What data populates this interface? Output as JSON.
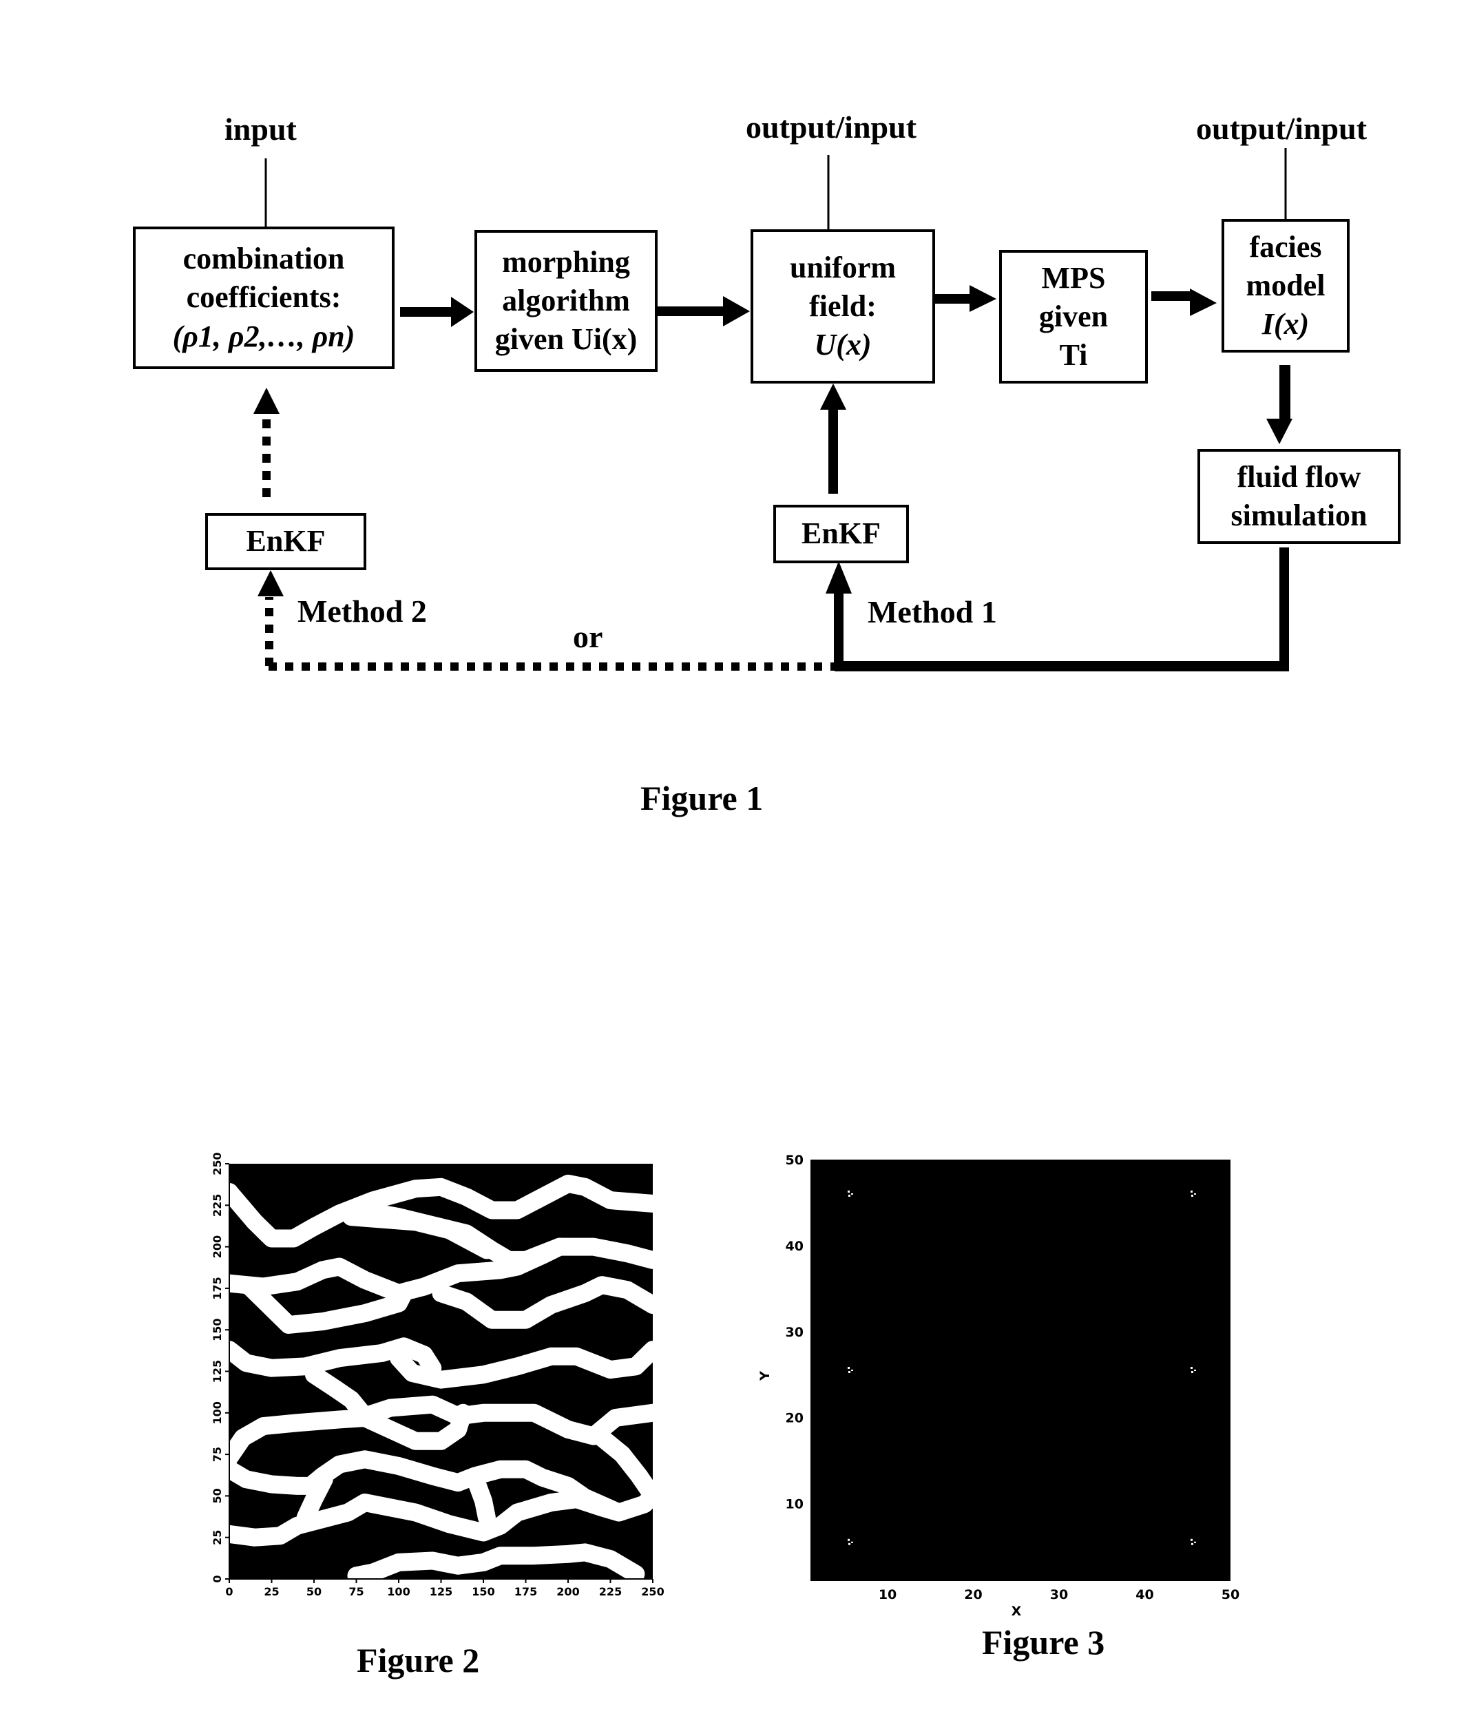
{
  "figure1": {
    "caption": "Figure 1",
    "top_labels": {
      "combination": "input",
      "uniform": "output/input",
      "facies": "output/input"
    },
    "boxes": {
      "combination": {
        "lines": [
          "combination",
          "coefficients:",
          "(ρ1, ρ2,…, ρn)"
        ]
      },
      "morphing": {
        "lines": [
          "morphing",
          "algorithm",
          "given Ui(x)"
        ]
      },
      "uniform": {
        "lines": [
          "uniform",
          "field:",
          "U(x)"
        ]
      },
      "mps": {
        "lines": [
          "MPS",
          "given",
          "Ti"
        ]
      },
      "facies": {
        "lines": [
          "facies",
          "model",
          "I(x)"
        ]
      },
      "fluid": {
        "lines": [
          "fluid flow",
          "simulation"
        ]
      },
      "enkf_method2": {
        "lines": [
          "EnKF"
        ]
      },
      "enkf_method1": {
        "lines": [
          "EnKF"
        ]
      }
    },
    "method_labels": {
      "method2": "Method 2",
      "method1": "Method 1",
      "or": "or"
    }
  },
  "figure2": {
    "caption": "Figure 2"
  },
  "figure3": {
    "caption": "Figure 3"
  },
  "chart_data": [
    {
      "type": "heatmap",
      "title": "Figure 2",
      "description": "Binary facies training image: white sinuous channels on black background",
      "xlabel": "",
      "ylabel": "",
      "xlim": [
        0,
        250
      ],
      "ylim": [
        0,
        250
      ],
      "x_ticks": [
        0,
        25,
        50,
        75,
        100,
        125,
        150,
        175,
        200,
        225,
        250
      ],
      "y_ticks": [
        0,
        25,
        50,
        75,
        100,
        125,
        150,
        175,
        200,
        225,
        250
      ],
      "colors": {
        "background": "#000000",
        "channel": "#ffffff"
      },
      "channel_centerlines": [
        [
          [
            0,
            233
          ],
          [
            15,
            215
          ],
          [
            25,
            205
          ],
          [
            38,
            205
          ],
          [
            50,
            212
          ],
          [
            65,
            220
          ],
          [
            85,
            228
          ],
          [
            110,
            235
          ],
          [
            125,
            236
          ],
          [
            140,
            230
          ],
          [
            155,
            222
          ],
          [
            170,
            222
          ],
          [
            185,
            230
          ],
          [
            200,
            238
          ],
          [
            210,
            236
          ],
          [
            225,
            228
          ],
          [
            250,
            226
          ]
        ],
        [
          [
            78,
            222
          ],
          [
            100,
            218
          ],
          [
            120,
            213
          ],
          [
            140,
            208
          ],
          [
            155,
            198
          ],
          [
            165,
            192
          ],
          [
            175,
            192
          ],
          [
            195,
            200
          ],
          [
            215,
            200
          ],
          [
            235,
            196
          ],
          [
            250,
            192
          ]
        ],
        [
          [
            72,
            218
          ],
          [
            110,
            215
          ],
          [
            130,
            210
          ],
          [
            152,
            198
          ]
        ],
        [
          [
            0,
            178
          ],
          [
            20,
            176
          ],
          [
            40,
            179
          ],
          [
            55,
            186
          ],
          [
            65,
            188
          ],
          [
            80,
            180
          ],
          [
            100,
            172
          ],
          [
            115,
            176
          ],
          [
            135,
            184
          ],
          [
            160,
            186
          ],
          [
            170,
            188
          ],
          [
            185,
            195
          ],
          [
            195,
            200
          ]
        ],
        [
          [
            12,
            176
          ],
          [
            25,
            163
          ],
          [
            35,
            153
          ],
          [
            55,
            155
          ],
          [
            80,
            160
          ],
          [
            100,
            166
          ],
          [
            103,
            172
          ]
        ],
        [
          [
            125,
            172
          ],
          [
            140,
            167
          ],
          [
            155,
            156
          ],
          [
            175,
            156
          ],
          [
            190,
            165
          ],
          [
            210,
            172
          ],
          [
            220,
            177
          ],
          [
            235,
            174
          ],
          [
            250,
            165
          ]
        ],
        [
          [
            0,
            138
          ],
          [
            10,
            130
          ],
          [
            25,
            127
          ],
          [
            45,
            128
          ],
          [
            65,
            133
          ],
          [
            90,
            136
          ],
          [
            103,
            140
          ],
          [
            115,
            135
          ],
          [
            120,
            127
          ]
        ],
        [
          [
            100,
            133
          ],
          [
            108,
            124
          ],
          [
            125,
            120
          ],
          [
            150,
            123
          ],
          [
            170,
            128
          ],
          [
            190,
            134
          ],
          [
            205,
            134
          ],
          [
            225,
            126
          ],
          [
            240,
            128
          ],
          [
            250,
            138
          ]
        ],
        [
          [
            50,
            123
          ],
          [
            62,
            115
          ],
          [
            72,
            108
          ],
          [
            80,
            98
          ],
          [
            95,
            103
          ],
          [
            120,
            105
          ],
          [
            135,
            98
          ],
          [
            150,
            100
          ],
          [
            180,
            100
          ],
          [
            200,
            90
          ],
          [
            215,
            86
          ],
          [
            228,
            97
          ],
          [
            250,
            100
          ]
        ],
        [
          [
            0,
            73
          ],
          [
            8,
            85
          ],
          [
            20,
            92
          ],
          [
            40,
            94
          ],
          [
            65,
            96
          ],
          [
            80,
            97
          ],
          [
            95,
            90
          ],
          [
            110,
            83
          ],
          [
            125,
            83
          ],
          [
            135,
            90
          ],
          [
            138,
            100
          ]
        ],
        [
          [
            0,
            66
          ],
          [
            10,
            60
          ],
          [
            25,
            57
          ],
          [
            40,
            56
          ],
          [
            48,
            56
          ],
          [
            55,
            62
          ],
          [
            65,
            69
          ],
          [
            80,
            72
          ],
          [
            100,
            68
          ],
          [
            120,
            62
          ],
          [
            135,
            58
          ],
          [
            145,
            62
          ],
          [
            160,
            66
          ],
          [
            175,
            66
          ],
          [
            185,
            61
          ],
          [
            200,
            56
          ],
          [
            210,
            49
          ],
          [
            230,
            40
          ],
          [
            245,
            45
          ],
          [
            250,
            50
          ]
        ],
        [
          [
            220,
            85
          ],
          [
            232,
            75
          ],
          [
            242,
            62
          ],
          [
            250,
            50
          ]
        ],
        [
          [
            45,
            37
          ],
          [
            50,
            48
          ],
          [
            56,
            60
          ]
        ],
        [
          [
            0,
            27
          ],
          [
            15,
            25
          ],
          [
            30,
            26
          ],
          [
            40,
            32
          ],
          [
            55,
            36
          ],
          [
            70,
            40
          ],
          [
            80,
            46
          ],
          [
            95,
            43
          ],
          [
            110,
            40
          ],
          [
            130,
            33
          ],
          [
            150,
            28
          ],
          [
            160,
            32
          ],
          [
            170,
            40
          ],
          [
            190,
            46
          ],
          [
            205,
            48
          ],
          [
            220,
            43
          ],
          [
            230,
            40
          ]
        ],
        [
          [
            146,
            58
          ],
          [
            150,
            47
          ],
          [
            152,
            37
          ]
        ],
        [
          [
            75,
            2
          ],
          [
            85,
            4
          ],
          [
            100,
            10
          ],
          [
            120,
            11
          ],
          [
            135,
            8
          ],
          [
            150,
            10
          ],
          [
            160,
            14
          ],
          [
            180,
            14
          ],
          [
            200,
            15
          ],
          [
            210,
            16
          ],
          [
            225,
            12
          ],
          [
            240,
            3
          ]
        ]
      ]
    },
    {
      "type": "scatter",
      "title": "Figure 3",
      "description": "Well locations on a black 50x50 grid",
      "xlabel": "X",
      "ylabel": "Y",
      "xlim": [
        1,
        50
      ],
      "ylim": [
        1,
        50
      ],
      "x_ticks": [
        10,
        20,
        30,
        40,
        50
      ],
      "y_ticks": [
        10,
        20,
        30,
        40,
        50
      ],
      "colors": {
        "background": "#000000",
        "marker": "#ffffff"
      },
      "points": [
        {
          "x": 5.5,
          "y": 46
        },
        {
          "x": 45.5,
          "y": 46
        },
        {
          "x": 5.5,
          "y": 25.5
        },
        {
          "x": 45.5,
          "y": 25.5
        },
        {
          "x": 5.5,
          "y": 5.5
        },
        {
          "x": 45.5,
          "y": 5.5
        }
      ]
    }
  ]
}
